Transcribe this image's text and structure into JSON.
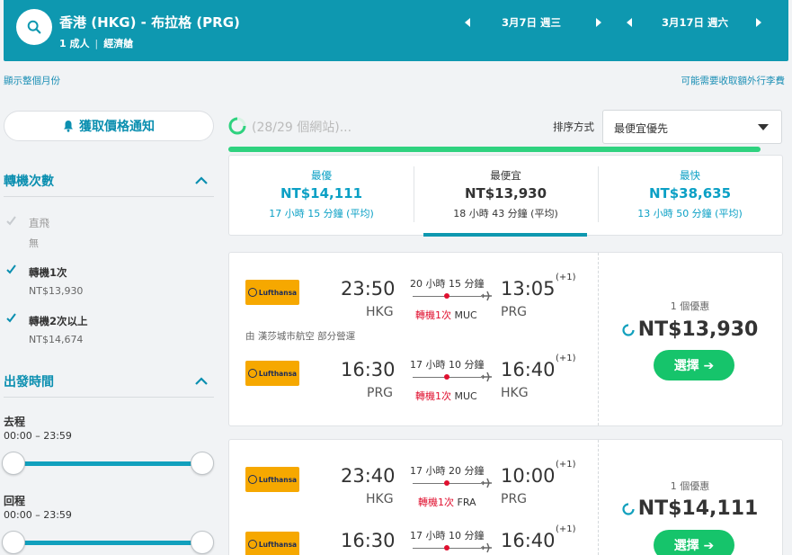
{
  "header": {
    "route": "香港 (HKG) - 布拉格 (PRG)",
    "passengers": "1 成人",
    "cabin": "經濟艙",
    "depart_date": "3月7日 週三",
    "return_date": "3月17日 週六"
  },
  "links": {
    "show_month": "顯示整個月份",
    "fees_notice": "可能需要收取額外行李費"
  },
  "filters": {
    "price_alert": "獲取價格通知",
    "stops_title": "轉機次數",
    "stops": [
      {
        "label": "直飛",
        "price": "無",
        "checked": true,
        "disabled": true
      },
      {
        "label": "轉機1次",
        "price": "NT$13,930",
        "checked": true,
        "disabled": false
      },
      {
        "label": "轉機2次以上",
        "price": "NT$14,674",
        "checked": true,
        "disabled": false
      }
    ],
    "departure_title": "出發時間",
    "outbound_label": "去程",
    "outbound_range": "00:00 – 23:59",
    "return_label": "回程",
    "return_range": "00:00 – 23:59"
  },
  "progress": {
    "sites_text": "(28/29 個網站)...",
    "fraction": 0.97
  },
  "sort": {
    "label": "排序方式",
    "value": "最便宜優先"
  },
  "tabs": [
    {
      "title": "最優",
      "price": "NT$14,111",
      "duration": "17 小時 15 分鐘 (平均)"
    },
    {
      "title": "最便宜",
      "price": "NT$13,930",
      "duration": "18 小時 43 分鐘 (平均)"
    },
    {
      "title": "最快",
      "price": "NT$38,635",
      "duration": "13 小時 50 分鐘 (平均)"
    }
  ],
  "results": [
    {
      "outbound": {
        "airline": "Lufthansa",
        "dep": "23:50",
        "arr": "13:05",
        "plus": "(+1)",
        "from": "HKG",
        "to": "PRG",
        "duration": "20 小時 15 分鐘",
        "stops": "轉機1次",
        "via": "MUC"
      },
      "operated": "由 漢莎城市航空 部分營運",
      "inbound": {
        "airline": "Lufthansa",
        "dep": "16:30",
        "arr": "16:40",
        "plus": "(+1)",
        "from": "PRG",
        "to": "HKG",
        "duration": "17 小時 10 分鐘",
        "stops": "轉機1次",
        "via": "MUC"
      },
      "deal_count": "1 個優惠",
      "price": "NT$13,930",
      "select": "選擇 ➔"
    },
    {
      "outbound": {
        "airline": "Lufthansa",
        "dep": "23:40",
        "arr": "10:00",
        "plus": "(+1)",
        "from": "HKG",
        "to": "PRG",
        "duration": "17 小時 20 分鐘",
        "stops": "轉機1次",
        "via": "FRA"
      },
      "inbound": {
        "airline": "Lufthansa",
        "dep": "16:30",
        "arr": "16:40",
        "plus": "(+1)",
        "duration": "17 小時 10 分鐘"
      },
      "deal_count": "1 個優惠",
      "price": "NT$14,111",
      "select": "選擇 ➔"
    }
  ],
  "colors": {
    "brand": "#0e98b0",
    "accent_green": "#16c46b",
    "stop_red": "#e0102f",
    "airline": "#f6a800"
  }
}
